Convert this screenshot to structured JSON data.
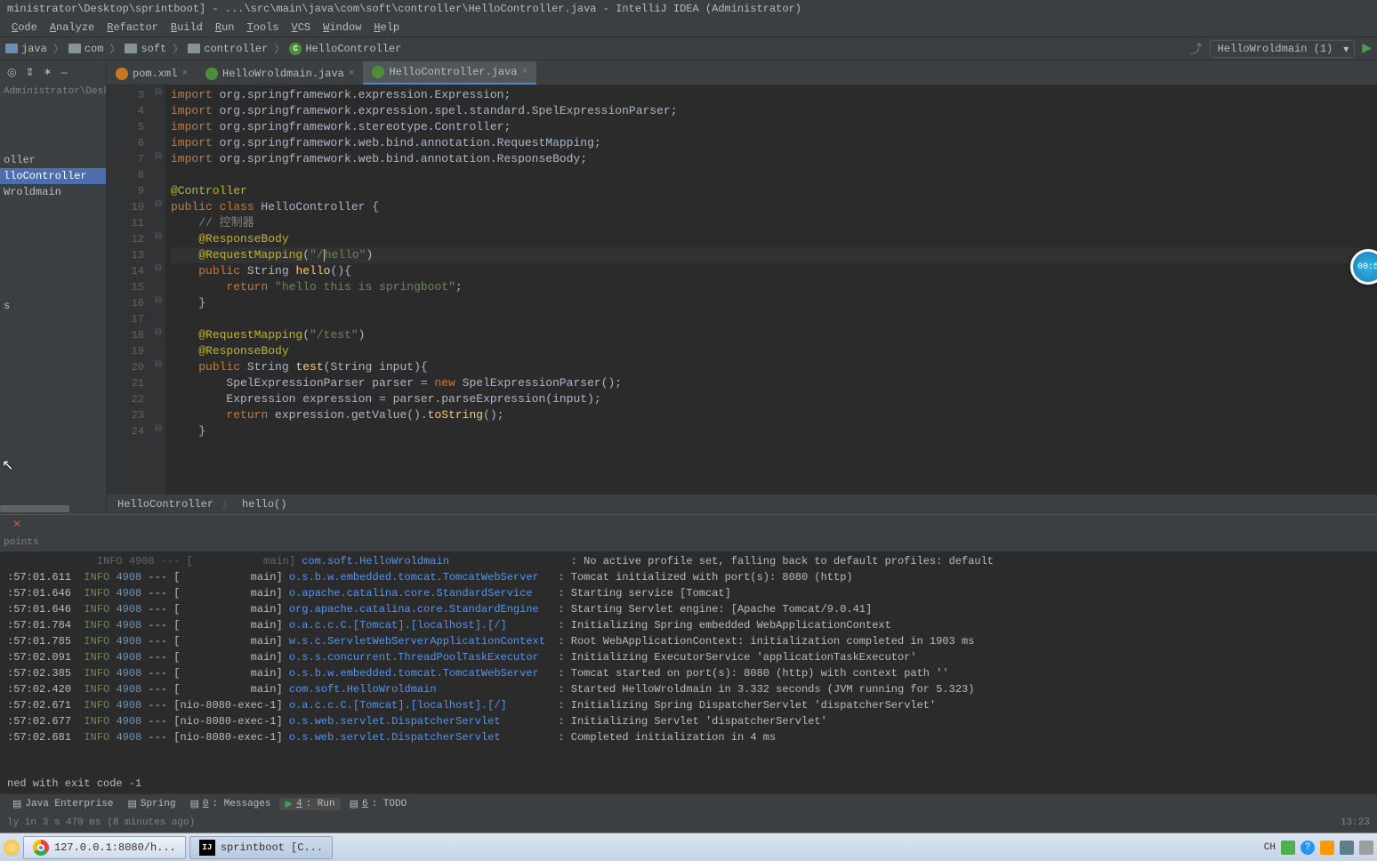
{
  "title": "ministrator\\Desktop\\sprintboot] - ...\\src\\main\\java\\com\\soft\\controller\\HelloController.java - IntelliJ IDEA (Administrator)",
  "menu": [
    "Code",
    "Analyze",
    "Refactor",
    "Build",
    "Run",
    "Tools",
    "VCS",
    "Window",
    "Help"
  ],
  "breadcrumb": [
    "java",
    "com",
    "soft",
    "controller",
    "HelloController"
  ],
  "run_config": "HelloWroldmain (1)",
  "sidebar": {
    "path": "Administrator\\Desktop\\s",
    "items": [
      "oller",
      "lloController",
      "Wroldmain",
      "s"
    ]
  },
  "tabs": [
    {
      "label": "pom.xml",
      "icon": "m"
    },
    {
      "label": "HelloWroldmain.java",
      "icon": "c"
    },
    {
      "label": "HelloController.java",
      "icon": "c",
      "active": true
    }
  ],
  "code_lines": [
    {
      "n": 3,
      "html": "<span class='kw'>import</span> org.springframework.expression.Expression;"
    },
    {
      "n": 4,
      "html": "<span class='kw'>import</span> org.springframework.expression.spel.standard.SpelExpressionParser;"
    },
    {
      "n": 5,
      "html": "<span class='kw'>import</span> org.springframework.stereotype.<span class='typ'>Controller</span>;"
    },
    {
      "n": 6,
      "html": "<span class='kw'>import</span> org.springframework.web.bind.annotation.<span class='typ'>RequestMapping</span>;"
    },
    {
      "n": 7,
      "html": "<span class='kw'>import</span> org.springframework.web.bind.annotation.<span class='typ'>ResponseBody</span>;"
    },
    {
      "n": 8,
      "html": ""
    },
    {
      "n": 9,
      "html": "<span class='an'>@Controller</span>"
    },
    {
      "n": 10,
      "html": "<span class='kw'>public class</span> HelloController {"
    },
    {
      "n": 11,
      "html": "    <span class='cmt'>// 控制器</span>"
    },
    {
      "n": 12,
      "html": "    <span class='an'>@ResponseBody</span>"
    },
    {
      "n": 13,
      "html": "    <span class='an'>@RequestMapping</span>(<span class='str'>\"/</span><span class='caret'></span><span class='str'>hello\"</span>)",
      "current": true
    },
    {
      "n": 14,
      "html": "    <span class='kw'>public</span> String <span class='mth'>hello</span>(){"
    },
    {
      "n": 15,
      "html": "        <span class='kw'>return</span> <span class='str'>\"hello this is springboot\"</span>;"
    },
    {
      "n": 16,
      "html": "    }"
    },
    {
      "n": 17,
      "html": ""
    },
    {
      "n": 18,
      "html": "    <span class='an'>@RequestMapping</span>(<span class='str'>\"/test\"</span>)"
    },
    {
      "n": 19,
      "html": "    <span class='an'>@ResponseBody</span>"
    },
    {
      "n": 20,
      "html": "    <span class='kw'>public</span> String <span class='mth'>test</span>(String input){"
    },
    {
      "n": 21,
      "html": "        SpelExpressionParser parser = <span class='kw'>new</span> SpelExpressionParser();"
    },
    {
      "n": 22,
      "html": "        Expression expression = parser.parseExpression(input);"
    },
    {
      "n": 23,
      "html": "        <span class='kw'>return</span> expression.getValue().<span class='mth'>toString</span>();"
    },
    {
      "n": 24,
      "html": "    }"
    }
  ],
  "editor_crumb": [
    "HelloController",
    "hello()"
  ],
  "run_subheader": "points",
  "console": [
    {
      "t": ":57:01.611",
      "cat": "o.s.b.w.embedded.tomcat.TomcatWebServer",
      "th": "main",
      "msg": "Tomcat initialized with port(s): 8080 (http)"
    },
    {
      "t": ":57:01.646",
      "cat": "o.apache.catalina.core.StandardService",
      "th": "main",
      "msg": "Starting service [Tomcat]"
    },
    {
      "t": ":57:01.646",
      "cat": "org.apache.catalina.core.StandardEngine",
      "th": "main",
      "msg": "Starting Servlet engine: [Apache Tomcat/9.0.41]"
    },
    {
      "t": ":57:01.784",
      "cat": "o.a.c.c.C.[Tomcat].[localhost].[/]",
      "th": "main",
      "msg": "Initializing Spring embedded WebApplicationContext"
    },
    {
      "t": ":57:01.785",
      "cat": "w.s.c.ServletWebServerApplicationContext",
      "th": "main",
      "msg": "Root WebApplicationContext: initialization completed in 1903 ms"
    },
    {
      "t": ":57:02.091",
      "cat": "o.s.s.concurrent.ThreadPoolTaskExecutor",
      "th": "main",
      "msg": "Initializing ExecutorService 'applicationTaskExecutor'"
    },
    {
      "t": ":57:02.385",
      "cat": "o.s.b.w.embedded.tomcat.TomcatWebServer",
      "th": "main",
      "msg": "Tomcat started on port(s): 8080 (http) with context path ''"
    },
    {
      "t": ":57:02.420",
      "cat": "com.soft.HelloWroldmain",
      "th": "main",
      "msg": "Started HelloWroldmain in 3.332 seconds (JVM running for 5.323)"
    },
    {
      "t": ":57:02.671",
      "cat": "o.a.c.c.C.[Tomcat].[localhost].[/]",
      "th": "nio-8080-exec-1",
      "msg": "Initializing Spring DispatcherServlet 'dispatcherServlet'"
    },
    {
      "t": ":57:02.677",
      "cat": "o.s.web.servlet.DispatcherServlet",
      "th": "nio-8080-exec-1",
      "msg": "Initializing Servlet 'dispatcherServlet'"
    },
    {
      "t": ":57:02.681",
      "cat": "o.s.web.servlet.DispatcherServlet",
      "th": "nio-8080-exec-1",
      "msg": "Completed initialization in 4 ms"
    }
  ],
  "console_pid": "4908",
  "console_first_line": {
    "th": "main",
    "cat": "com.soft.HelloWroldmain",
    "msg": "No active profile set, falling back to default profiles: default"
  },
  "exit_text": "ned with exit code -1",
  "tool_tabs": [
    {
      "label": "Java Enterprise"
    },
    {
      "label": "Spring"
    },
    {
      "label": "0: Messages",
      "u": "0"
    },
    {
      "label": "4: Run",
      "u": "4",
      "active": true,
      "play": true
    },
    {
      "label": "6: TODO",
      "u": "6"
    }
  ],
  "status_left": "ly in 3 s 470 ms (8 minutes ago)",
  "status_right": "13:23",
  "taskbar": {
    "chrome": "127.0.0.1:8080/h...",
    "ij": "sprintboot [C...",
    "tray_lang": "CH"
  },
  "timer": "00:5"
}
